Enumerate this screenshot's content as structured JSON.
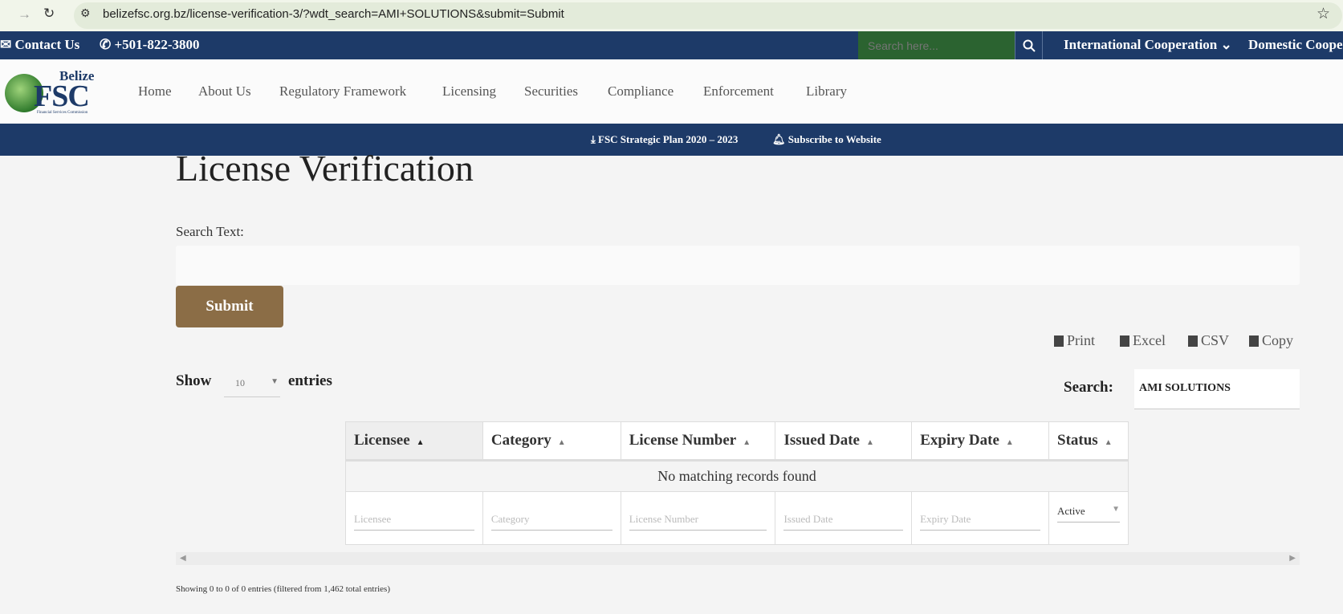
{
  "browser": {
    "url": "belizefsc.org.bz/license-verification-3/?wdt_search=AMI+SOLUTIONS&submit=Submit"
  },
  "topbar": {
    "contact": "Contact Us",
    "phone": "+501-822-3800",
    "search_placeholder": "Search here...",
    "menu": [
      "International Cooperation",
      "Domestic Cooper"
    ]
  },
  "logo": {
    "top": "Belize",
    "main": "FSC",
    "sub": "Financial Services Commission"
  },
  "nav": [
    "Home",
    "About Us",
    "Regulatory Framework",
    "Licensing",
    "Securities",
    "Compliance",
    "Enforcement",
    "Library"
  ],
  "strip": {
    "plan": "FSC Strategic Plan 2020 – 2023",
    "subscribe": "Subscribe to Website"
  },
  "page": {
    "title": "License Verification",
    "search_label": "Search Text:",
    "search_value": "",
    "submit": "Submit"
  },
  "export": [
    "Print",
    "Excel",
    "CSV",
    "Copy"
  ],
  "table_controls": {
    "show": "Show",
    "entries_value": "10",
    "entries": "entries",
    "search_label": "Search:",
    "search_value": "AMI SOLUTIONS"
  },
  "table": {
    "columns": [
      "Licensee",
      "Category",
      "License Number",
      "Issued Date",
      "Expiry Date",
      "Status"
    ],
    "empty": "No matching records found",
    "filters": [
      "Licensee",
      "Category",
      "License Number",
      "Issued Date",
      "Expiry Date"
    ],
    "status_filter": "Active"
  },
  "info": "Showing 0 to 0 of 0 entries (filtered from 1,462 total entries)",
  "colors": {
    "navy": "#1d3a68",
    "green": "#2b6330",
    "submit": "#8b6d46"
  }
}
